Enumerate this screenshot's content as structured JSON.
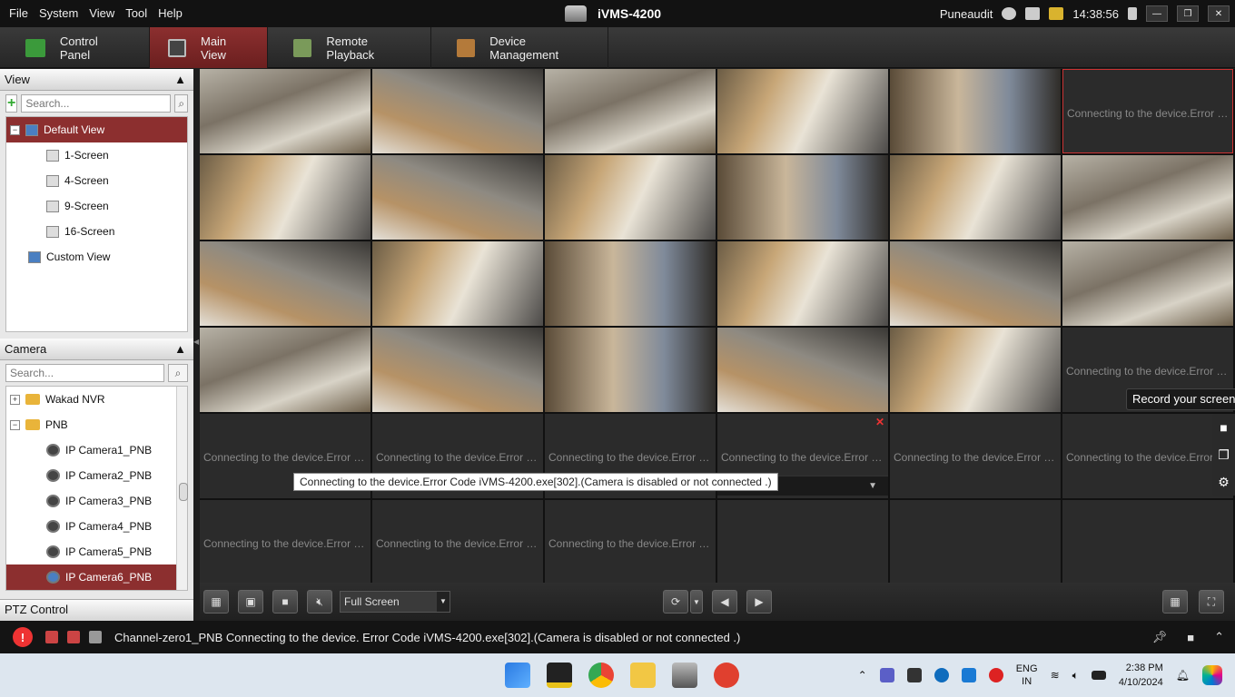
{
  "menu": [
    "File",
    "System",
    "View",
    "Tool",
    "Help"
  ],
  "app_title": "iVMS-4200",
  "user": "Puneaudit",
  "clock": "14:38:56",
  "window_buttons": [
    "—",
    "❐",
    "✕"
  ],
  "tabs": [
    {
      "label": "Control Panel"
    },
    {
      "label": "Main View"
    },
    {
      "label": "Remote Playback"
    },
    {
      "label": "Device Management"
    }
  ],
  "view_panel": {
    "title": "View",
    "search_placeholder": "Search...",
    "items": [
      {
        "label": "Default View"
      },
      {
        "label": "1-Screen"
      },
      {
        "label": "4-Screen"
      },
      {
        "label": "9-Screen"
      },
      {
        "label": "16-Screen"
      },
      {
        "label": "Custom View"
      }
    ]
  },
  "camera_panel": {
    "title": "Camera",
    "search_placeholder": "Search...",
    "items": [
      {
        "label": "Wakad NVR"
      },
      {
        "label": "PNB"
      },
      {
        "label": "IP Camera1_PNB"
      },
      {
        "label": "IP Camera2_PNB"
      },
      {
        "label": "IP Camera3_PNB"
      },
      {
        "label": "IP Camera4_PNB"
      },
      {
        "label": "IP Camera5_PNB"
      },
      {
        "label": "IP Camera6_PNB"
      }
    ]
  },
  "ptz_title": "PTZ Control",
  "grid_error": "Connecting to the device.Error Code iVMS-4200.exe[302].(Camera is disabled or not connected .)",
  "tooltip": "Connecting to the device.Error Code iVMS-4200.exe[302].(Camera is disabled or not connected .)",
  "record_tip": "Record your screen",
  "toolbar": {
    "mode_select": "Full Screen"
  },
  "status_message": "Channel-zero1_PNB Connecting to the device. Error Code iVMS-4200.exe[302].(Camera is disabled or not connected .)",
  "taskbar": {
    "lang_top": "ENG",
    "lang_bottom": "IN",
    "time": "2:38 PM",
    "date": "4/10/2024"
  },
  "colors": {
    "accent": "#8c2f2f",
    "error_x": "#e33333"
  }
}
